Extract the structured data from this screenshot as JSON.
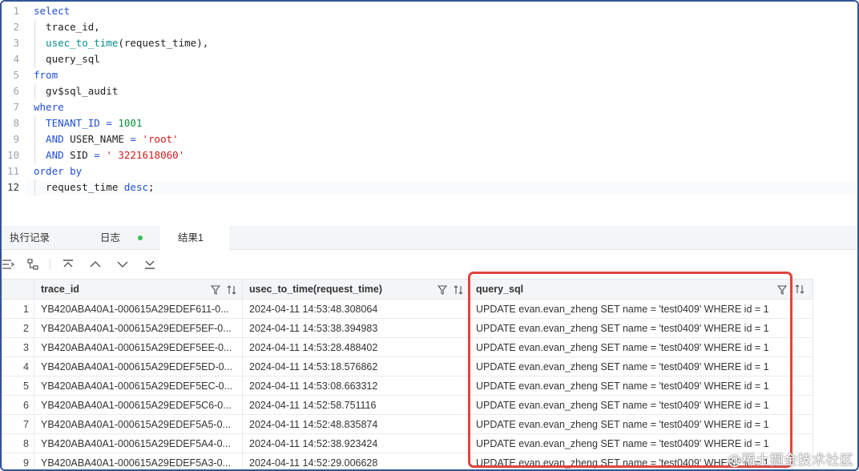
{
  "editor": {
    "lines": [
      {
        "n": "1",
        "tokens": [
          {
            "t": "select",
            "c": "kw"
          }
        ]
      },
      {
        "n": "2",
        "tokens": [
          {
            "t": "  trace_id,",
            "c": "id"
          }
        ]
      },
      {
        "n": "3",
        "tokens": [
          {
            "t": "  usec_to_time",
            "c": "fn"
          },
          {
            "t": "(request_time),",
            "c": "id"
          }
        ]
      },
      {
        "n": "4",
        "tokens": [
          {
            "t": "  query_sql",
            "c": "id"
          }
        ]
      },
      {
        "n": "5",
        "tokens": [
          {
            "t": "from",
            "c": "kw"
          }
        ]
      },
      {
        "n": "6",
        "tokens": [
          {
            "t": "  gv$sql_audit",
            "c": "id"
          }
        ]
      },
      {
        "n": "7",
        "tokens": [
          {
            "t": "where",
            "c": "kw"
          }
        ]
      },
      {
        "n": "8",
        "tokens": [
          {
            "t": "  TENANT_ID",
            "c": "kw"
          },
          {
            "t": " = ",
            "c": "kw"
          },
          {
            "t": "1001",
            "c": "num"
          }
        ]
      },
      {
        "n": "9",
        "tokens": [
          {
            "t": "  AND",
            "c": "kw"
          },
          {
            "t": " USER_NAME ",
            "c": "id"
          },
          {
            "t": "= ",
            "c": "kw"
          },
          {
            "t": "'root'",
            "c": "str"
          }
        ]
      },
      {
        "n": "10",
        "tokens": [
          {
            "t": "  AND",
            "c": "kw"
          },
          {
            "t": " SID ",
            "c": "id"
          },
          {
            "t": "= ",
            "c": "kw"
          },
          {
            "t": "' 3221618060'",
            "c": "str"
          }
        ]
      },
      {
        "n": "11",
        "tokens": [
          {
            "t": "order by",
            "c": "kw"
          }
        ]
      },
      {
        "n": "12",
        "tokens": [
          {
            "t": "  request_time ",
            "c": "id"
          },
          {
            "t": "desc",
            "c": "kw"
          },
          {
            "t": ";",
            "c": "id"
          }
        ]
      }
    ]
  },
  "tabs": [
    {
      "label": "执行记录",
      "active": false
    },
    {
      "label": "日志",
      "active": false,
      "status": "success"
    },
    {
      "label": "结果1",
      "active": true
    }
  ],
  "toolbar": {
    "icons": [
      "expand-rows-icon",
      "tree-view-icon",
      "first-row-icon",
      "previous-row-icon",
      "next-row-icon",
      "last-row-icon"
    ]
  },
  "grid": {
    "columns": [
      "trace_id",
      "usec_to_time(request_time)",
      "query_sql"
    ],
    "rows": [
      [
        "1",
        "YB420ABA40A1-000615A29EDEF611-0...",
        "2024-04-11 14:53:48.308064",
        "UPDATE evan.evan_zheng SET name = 'test0409' WHERE id = 1"
      ],
      [
        "2",
        "YB420ABA40A1-000615A29EDEF5EF-0...",
        "2024-04-11 14:53:38.394983",
        "UPDATE evan.evan_zheng SET name = 'test0409' WHERE id = 1"
      ],
      [
        "3",
        "YB420ABA40A1-000615A29EDEF5EE-0...",
        "2024-04-11 14:53:28.488402",
        "UPDATE evan.evan_zheng SET name = 'test0409' WHERE id = 1"
      ],
      [
        "4",
        "YB420ABA40A1-000615A29EDEF5ED-0...",
        "2024-04-11 14:53:18.576862",
        "UPDATE evan.evan_zheng SET name = 'test0409' WHERE id = 1"
      ],
      [
        "5",
        "YB420ABA40A1-000615A29EDEF5EC-0...",
        "2024-04-11 14:53:08.663312",
        "UPDATE evan.evan_zheng SET name = 'test0409' WHERE id = 1"
      ],
      [
        "6",
        "YB420ABA40A1-000615A29EDEF5C6-0...",
        "2024-04-11 14:52:58.751116",
        "UPDATE evan.evan_zheng SET name = 'test0409' WHERE id = 1"
      ],
      [
        "7",
        "YB420ABA40A1-000615A29EDEF5A5-0...",
        "2024-04-11 14:52:48.835874",
        "UPDATE evan.evan_zheng SET name = 'test0409' WHERE id = 1"
      ],
      [
        "8",
        "YB420ABA40A1-000615A29EDEF5A4-0...",
        "2024-04-11 14:52:38.923424",
        "UPDATE evan.evan_zheng SET name = 'test0409' WHERE id = 1"
      ],
      [
        "9",
        "YB420ABA40A1-000615A29EDEF5A3-0...",
        "2024-04-11 14:52:29.006628",
        "UPDATE evan.evan_zheng SET name = 'test0409' WHERE id = 1"
      ]
    ]
  },
  "watermark": "@稀土掘金技术社区",
  "colors": {
    "keyword": "#1f4fd6",
    "function": "#0a8c8c",
    "number": "#0a8f3c",
    "string": "#d11a1a",
    "highlight_border": "#e0443c",
    "frame_border": "#2f5597",
    "status_dot": "#35c25a"
  }
}
